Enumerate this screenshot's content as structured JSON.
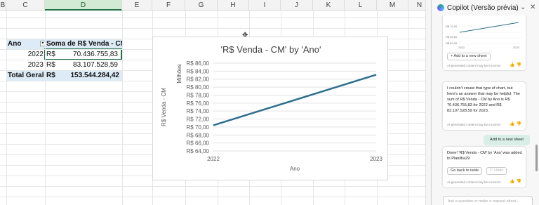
{
  "columns": [
    {
      "letter": "B",
      "sel": false
    },
    {
      "letter": "C",
      "sel": false
    },
    {
      "letter": "D",
      "sel": true
    },
    {
      "letter": "E",
      "sel": false
    },
    {
      "letter": "F",
      "sel": false
    },
    {
      "letter": "G",
      "sel": false
    },
    {
      "letter": "H",
      "sel": false
    },
    {
      "letter": "I",
      "sel": false
    },
    {
      "letter": "J",
      "sel": false
    },
    {
      "letter": "K",
      "sel": false
    },
    {
      "letter": "L",
      "sel": false
    },
    {
      "letter": "M",
      "sel": false
    },
    {
      "letter": "N",
      "sel": false
    }
  ],
  "pivot": {
    "header_label": "Ano",
    "header_value": "Soma de R$ Venda - CM",
    "rows": [
      {
        "year": "2022",
        "currency": "R$",
        "value": "70.436.755,83"
      },
      {
        "year": "2023",
        "currency": "R$",
        "value": "83.107.528,59"
      }
    ],
    "total_label": "Total Geral",
    "total_currency": "R$",
    "total_value": "153.544.284,42"
  },
  "chart_data": {
    "type": "line",
    "title": "'R$ Venda - CM' by 'Ano'",
    "xlabel": "Ano",
    "ylabel": "R$ Venda - CM",
    "unit_label": "Milhões",
    "categories": [
      "2022",
      "2023"
    ],
    "series": [
      {
        "values": [
          70.44,
          83.11
        ],
        "color": "#2e6e8e"
      }
    ],
    "ylim": [
      64,
      86
    ],
    "yticks": [
      "R$ 64,00",
      "R$ 66,00",
      "R$ 68,00",
      "R$ 70,00",
      "R$ 72,00",
      "R$ 74,00",
      "R$ 76,00",
      "R$ 78,00",
      "R$ 80,00",
      "R$ 82,00",
      "R$ 84,00",
      "R$ 86,00"
    ],
    "grid": true
  },
  "copilot": {
    "title": "Copilot (Versão prévia)",
    "card1": {
      "mini_chart": {
        "yticks": [
          "R$ 70,00",
          "R$ 65,00",
          "R$ 60,00"
        ],
        "xticks": [
          "2022",
          "2023"
        ]
      },
      "add_button": "Add to a new sheet",
      "note": "AI-generated content may be incorrect"
    },
    "card2": {
      "text": "I couldn't create that type of chart, but here's an answer that may be helpful. The sum of R$ Venda - CM by Ano is R$ 70.436.755,83 for 2022 and R$ 83.107.528,59 for 2023.",
      "note": "AI-generated content may be incorrect"
    },
    "user_message": "Add to a new sheet",
    "card3": {
      "text": "Done! 'R$ Venda - CM' by 'Ano' was added to Planilha29",
      "go_back": "Go back to table",
      "undo": "Undo",
      "note": "AI-generated content may be incorrect"
    },
    "input_placeholder": "Ask a question or make a request about..."
  }
}
